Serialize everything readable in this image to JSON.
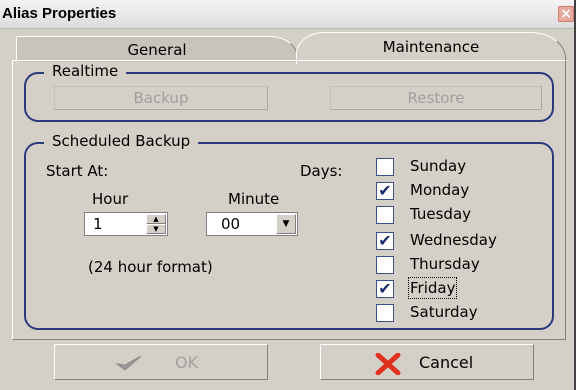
{
  "window": {
    "title": "Alias Properties",
    "close_glyph": "×"
  },
  "tabs": [
    {
      "label": "General",
      "selected": false
    },
    {
      "label": "Maintenance",
      "selected": true
    }
  ],
  "realtime": {
    "legend": "Realtime",
    "backup_label": "Backup",
    "restore_label": "Restore"
  },
  "scheduled": {
    "legend": "Scheduled Backup",
    "start_at_label": "Start At:",
    "hour_label": "Hour",
    "hour_value": "1",
    "minute_label": "Minute",
    "minute_value": "00",
    "format_note": "(24 hour format)",
    "days_label": "Days:",
    "days": [
      {
        "label": "Sunday",
        "checked": false
      },
      {
        "label": "Monday",
        "checked": true
      },
      {
        "label": "Tuesday",
        "checked": false
      },
      {
        "label": "Wednesday",
        "checked": true
      },
      {
        "label": "Thursday",
        "checked": false
      },
      {
        "label": "Friday",
        "checked": true,
        "focused": true
      },
      {
        "label": "Saturday",
        "checked": false
      }
    ]
  },
  "actions": {
    "ok_label": "OK",
    "ok_icon": "checkmark-icon",
    "ok_enabled": false,
    "cancel_label": "Cancel",
    "cancel_icon": "red-x-icon"
  },
  "colors": {
    "group_border": "#2a3a7a",
    "cancel_icon": "#e0301e",
    "ok_icon_disabled": "#9a9a9a"
  }
}
